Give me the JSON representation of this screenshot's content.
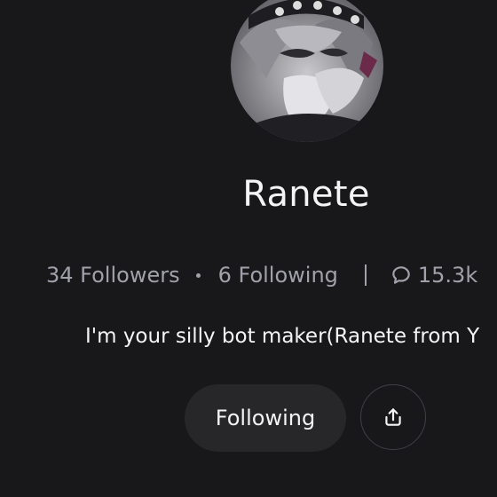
{
  "profile": {
    "name": "Ranete",
    "bio": "I'm your silly bot maker(Ranete from Y"
  },
  "stats": {
    "followers": "34 Followers",
    "following": "6 Following",
    "chats": "15.3k"
  },
  "actions": {
    "following_label": "Following"
  },
  "icons": {
    "chat": "chat-bubble-icon",
    "share": "share-icon"
  },
  "colors": {
    "background": "#18181b",
    "button": "#27272a",
    "muted_text": "#a1a1aa",
    "text": "#f4f4f5"
  }
}
